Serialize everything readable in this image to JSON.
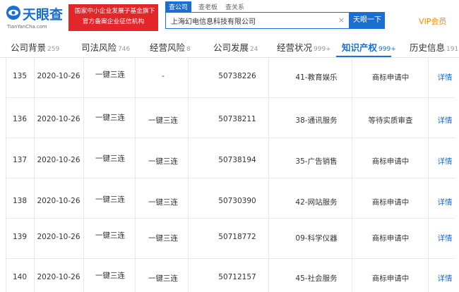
{
  "logo": {
    "name": "天眼查",
    "domain": "TianYanCha.com"
  },
  "badge": {
    "line1": "国家中小企业发展子基金旗下",
    "line2": "官方备案企业征信机构"
  },
  "search": {
    "tabs": [
      "查公司",
      "查老板",
      "查关系"
    ],
    "value": "上海幻电信息科技有限公司",
    "clear": "×",
    "button": "天眼一下"
  },
  "vip": "VIP会员",
  "nav": [
    {
      "label": "公司背景",
      "count": "259"
    },
    {
      "label": "司法风险",
      "count": "746"
    },
    {
      "label": "经营风险",
      "count": "8"
    },
    {
      "label": "公司发展",
      "count": "24"
    },
    {
      "label": "经营状况",
      "count": "999+"
    },
    {
      "label": "知识产权",
      "count": "999+"
    },
    {
      "label": "历史信息",
      "count": "191"
    }
  ],
  "rows": [
    {
      "idx": "135",
      "date": "2020-10-26",
      "name": "一键三连",
      "name2": "-",
      "reg": "50738226",
      "cls": "41-教育娱乐",
      "status": "商标申请中",
      "detail": "详情"
    },
    {
      "idx": "136",
      "date": "2020-10-26",
      "name": "一键三连",
      "name2": "一键三连",
      "reg": "50738211",
      "cls": "38-通讯服务",
      "status": "等待实质审查",
      "detail": "详情"
    },
    {
      "idx": "137",
      "date": "2020-10-26",
      "name": "一键三连",
      "name2": "一键三连",
      "reg": "50738194",
      "cls": "35-广告销售",
      "status": "商标申请中",
      "detail": "详情"
    },
    {
      "idx": "138",
      "date": "2020-10-26",
      "name": "一键三连",
      "name2": "一键三连",
      "reg": "50730390",
      "cls": "42-网站服务",
      "status": "商标申请中",
      "detail": "详情"
    },
    {
      "idx": "139",
      "date": "2020-10-26",
      "name": "一键三连",
      "name2": "一键三连",
      "reg": "50718772",
      "cls": "09-科学仪器",
      "status": "商标申请中",
      "detail": "详情"
    },
    {
      "idx": "140",
      "date": "2020-10-26",
      "name": "一键三连",
      "name2": "一键三连",
      "reg": "50712157",
      "cls": "45-社会服务",
      "status": "商标申请中",
      "detail": "详情"
    }
  ]
}
